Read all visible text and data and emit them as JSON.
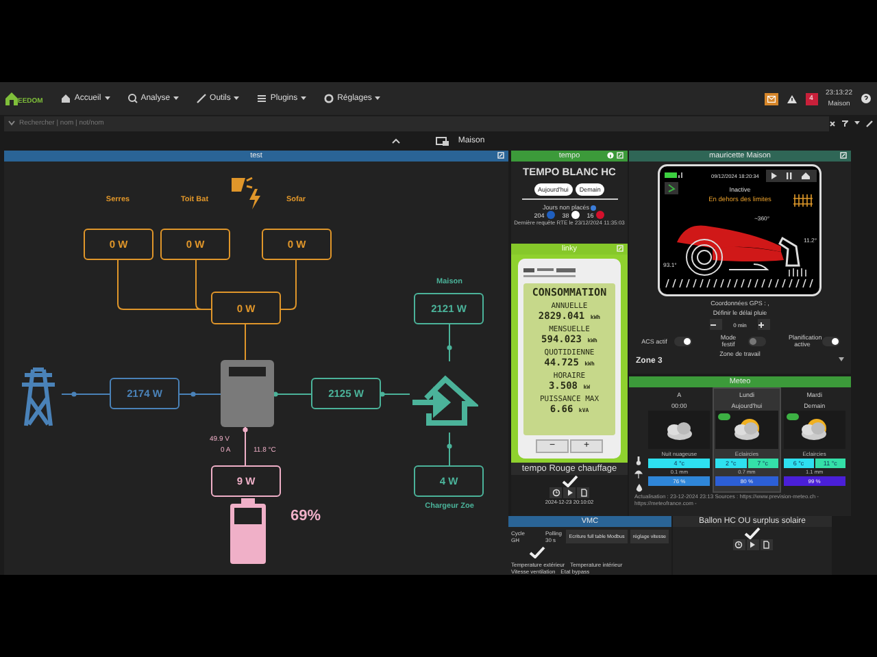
{
  "navbar": {
    "logo_text": "EEDOM",
    "menus": [
      {
        "label": "Accueil",
        "kind": "home"
      },
      {
        "label": "Analyse",
        "kind": "analysis"
      },
      {
        "label": "Outils",
        "kind": "tools"
      },
      {
        "label": "Plugins",
        "kind": "plugins"
      },
      {
        "label": "Réglages",
        "kind": "settings"
      }
    ],
    "alert_count": "4",
    "time": "23:13:22",
    "user": "Maison"
  },
  "search": {
    "placeholder": "Rechercher | nom | not/nom"
  },
  "page_title": "Maison",
  "energy": {
    "title": "test",
    "sources": [
      {
        "label": "Serres",
        "value": "0 W"
      },
      {
        "label": "Toit Bat",
        "value": "0 W"
      },
      {
        "label": "Sofar",
        "value": "0 W"
      }
    ],
    "solar_total": "0 W",
    "grid": "2174 W",
    "home_flow": "2125 W",
    "home": {
      "label": "Maison",
      "value": "2121 W"
    },
    "charger": {
      "label": "Chargeur Zoe",
      "value": "4 W"
    },
    "battery": {
      "voltage": "49.9 V",
      "current": "0 A",
      "temperature": "11.8 °C",
      "power": "9 W",
      "percent": "69%",
      "level": 0.69
    }
  },
  "tempo": {
    "title": "tempo",
    "heading": "TEMPO BLANC HC",
    "buttons": [
      {
        "label": "Aujourd'hui"
      },
      {
        "label": "Demain"
      }
    ],
    "days_label": "Jours non placés",
    "counts": [
      {
        "value": "204",
        "color": "#1f5fbf"
      },
      {
        "value": "38",
        "color": "#ffffff"
      },
      {
        "value": "16",
        "color": "#d4102c"
      }
    ],
    "note": "Dernière requête RTE le 23/12/2024 11:35:03"
  },
  "linky": {
    "title": "linky",
    "heading": "CONSOMMATION",
    "rows": [
      {
        "label": "ANNUELLE",
        "value": "2829.041",
        "unit": "kWh"
      },
      {
        "label": "MENSUELLE",
        "value": "594.023",
        "unit": "kWh"
      },
      {
        "label": "QUOTIDIENNE",
        "value": "44.725",
        "unit": "kWh"
      },
      {
        "label": "HORAIRE",
        "value": "3.508",
        "unit": "kW"
      },
      {
        "label": "PUISSANCE MAX",
        "value": "6.66",
        "unit": "kVA"
      }
    ],
    "buttons": [
      "−",
      "+"
    ]
  },
  "tempo_rouge": {
    "title": "tempo Rouge chauffage",
    "checked": true,
    "date": "2024-12-23 20:10:02"
  },
  "mower": {
    "title": "mauricette Maison",
    "date": "09/12/2024 18:20:34",
    "status": "Inactive",
    "alert": "En dehors des limites",
    "angle_top": "~360°",
    "angle_right": "11.2°",
    "angle_left": "93.1°",
    "gps_label": "Coordonnées GPS : ,",
    "rain_label": "Définir le délai pluie",
    "rain_value": "0 min",
    "toggles": [
      {
        "label": "ACS actif",
        "on": true
      },
      {
        "label": "Mode festif",
        "on": false
      },
      {
        "label": "Planification active",
        "on": true
      }
    ],
    "zone_label": "Zone de travail",
    "zone": "Zone 3"
  },
  "meteo": {
    "title": "Meteo",
    "days": [
      {
        "name": "A",
        "sub": "00:00",
        "kind": "night_cloudy",
        "badge": false,
        "selected": false,
        "desc": "Nuit nuageuse",
        "temps": [
          "4 °c"
        ],
        "rain": "0.1 mm",
        "humidity": {
          "value": "76 %",
          "color": "#2f86d8"
        }
      },
      {
        "name": "Lundi",
        "sub": "Aujourd'hui",
        "kind": "sun_cloud",
        "badge": true,
        "selected": true,
        "desc": "Eclaircies",
        "temps": [
          "2 °c",
          "7 °c"
        ],
        "rain": "0.7 mm",
        "humidity": {
          "value": "80 %",
          "color": "#2c5fd6"
        }
      },
      {
        "name": "Mardi",
        "sub": "Demain",
        "kind": "sun_cloud",
        "badge": true,
        "selected": false,
        "desc": "Eclaircies",
        "temps": [
          "6 °c",
          "11 °c"
        ],
        "rain": "1.1 mm",
        "humidity": {
          "value": "99 %",
          "color": "#4a1fd8"
        }
      }
    ],
    "footer": "Actualisation : 23-12-2024 23:13 Sources : https://www.prevision-meteo.ch - https://meteofrance.com -"
  },
  "vmc": {
    "title": "VMC",
    "labels": [
      "Cycle GH",
      "Polling 30 s"
    ],
    "checked": true,
    "buttons": [
      "Ecriture full table Modbus",
      "réglage vitesse"
    ],
    "items": [
      "Temperature extérieur",
      "Temperature intérieur",
      "Vitesse ventilation",
      "Etat bypass"
    ]
  },
  "ballon": {
    "title": "Ballon HC OU surplus solaire",
    "checked": true
  }
}
